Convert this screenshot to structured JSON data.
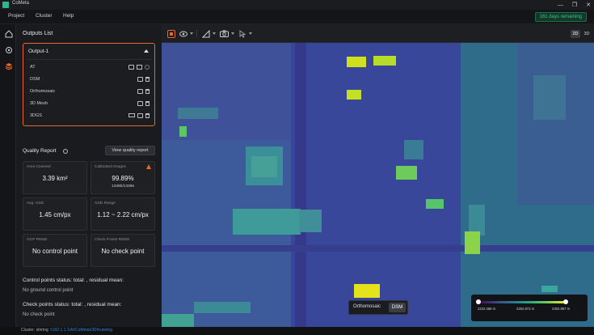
{
  "app": {
    "title": "CoMeta"
  },
  "menu": {
    "items": [
      "Project",
      "Cluster",
      "Help"
    ],
    "trial": "161 days remaining"
  },
  "outputs": {
    "title": "Outputs List",
    "group": "Output-1",
    "rows": [
      {
        "label": "AT"
      },
      {
        "label": "DSM"
      },
      {
        "label": "Orthomosaic"
      },
      {
        "label": "3D Mesh"
      },
      {
        "label": "3DGS"
      }
    ]
  },
  "quality": {
    "title": "Quality Report",
    "button": "View quality report",
    "cards": {
      "area": {
        "label": "Area Covered",
        "value": "3.39 km²"
      },
      "calibrated": {
        "label": "Calibrated Images",
        "value": "99.89%",
        "sub": "13380/13395"
      },
      "gsd": {
        "label": "Avg. GSD",
        "value": "1.45 cm/px"
      },
      "gsd_range": {
        "label": "GSD Range",
        "value": "1.12 ~ 2.22 cm/px"
      },
      "gcp": {
        "label": "GCP RMSE",
        "value": "No control point"
      },
      "check": {
        "label": "Check Points RMSE",
        "value": "No check point"
      }
    },
    "control_status": "Control points status: total: , residual mean:",
    "control_sub": "No ground control point",
    "check_status": "Check points status: total: , residual mean:",
    "check_sub": "No check point"
  },
  "statusbar": {
    "label": "Cluster: stirring",
    "link": "\\\\192.1.1.1\\AI\\CoMeta\\ODI\\running"
  },
  "view": {
    "btn_2d": "2D",
    "btn_3d": "3D"
  },
  "layer_switch": {
    "ortho": "Orthomosaic",
    "dsm": "DSM"
  },
  "legend": {
    "min": "2222.368 m",
    "mid": "2262.873 m",
    "max": "2302.887 m"
  },
  "colors": {
    "accent": "#e8672b",
    "trial_green": "#48c08a",
    "map_base": "#3a4c96"
  },
  "window": {
    "controls": [
      "—",
      "❐",
      "✕"
    ]
  }
}
